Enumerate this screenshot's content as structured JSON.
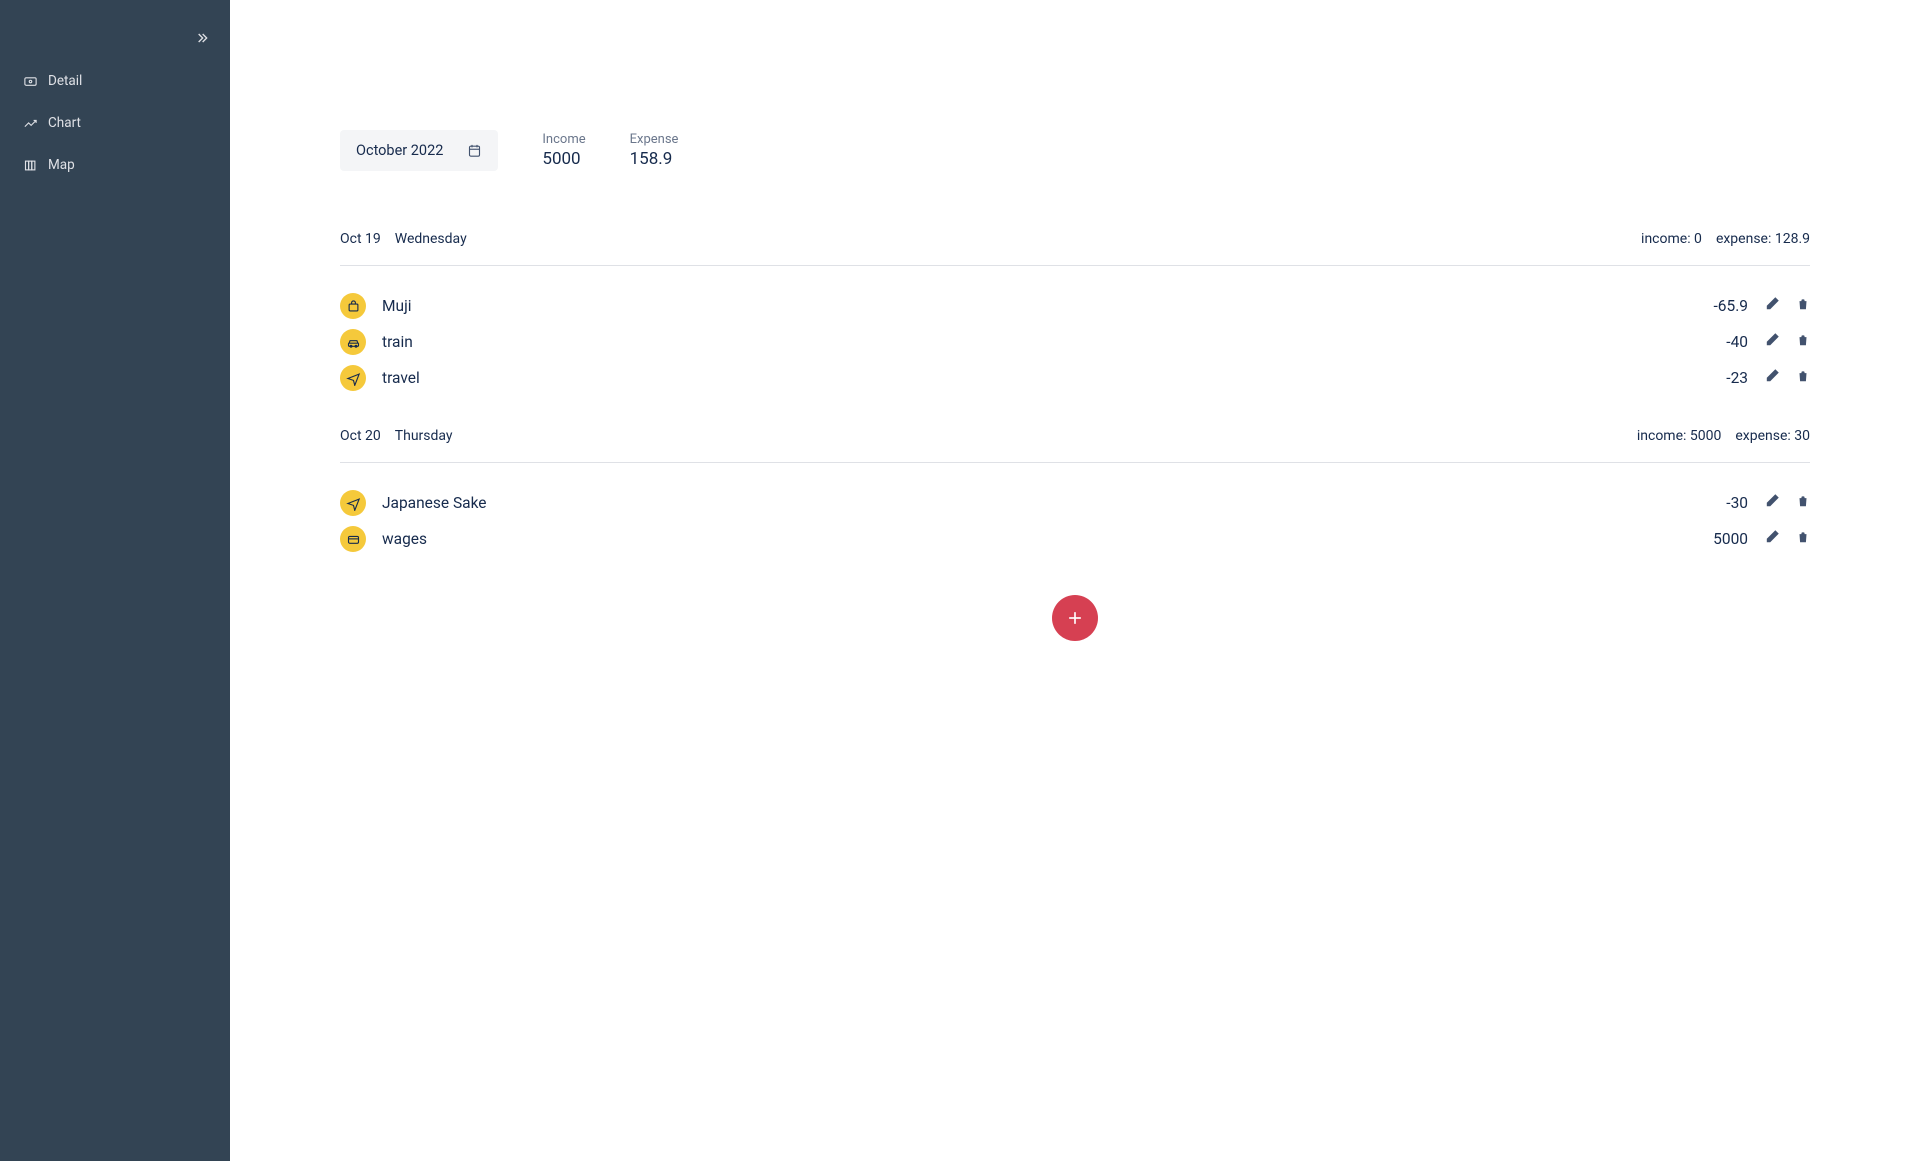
{
  "sidebar": {
    "items": [
      {
        "label": "Detail",
        "icon": "money"
      },
      {
        "label": "Chart",
        "icon": "chart"
      },
      {
        "label": "Map",
        "icon": "map"
      }
    ]
  },
  "header": {
    "month": "October 2022",
    "incomeLabel": "Income",
    "incomeValue": "5000",
    "expenseLabel": "Expense",
    "expenseValue": "158.9"
  },
  "days": [
    {
      "date": "Oct 19",
      "weekday": "Wednesday",
      "incomeText": "income: 0",
      "expenseText": "expense: 128.9",
      "records": [
        {
          "icon": "bag",
          "title": "Muji",
          "amount": "-65.9"
        },
        {
          "icon": "car",
          "title": "train",
          "amount": "-40"
        },
        {
          "icon": "plane",
          "title": "travel",
          "amount": "-23"
        }
      ]
    },
    {
      "date": "Oct 20",
      "weekday": "Thursday",
      "incomeText": "income: 5000",
      "expenseText": "expense: 30",
      "records": [
        {
          "icon": "plane",
          "title": "Japanese Sake",
          "amount": "-30"
        },
        {
          "icon": "card",
          "title": "wages",
          "amount": "5000"
        }
      ]
    }
  ]
}
